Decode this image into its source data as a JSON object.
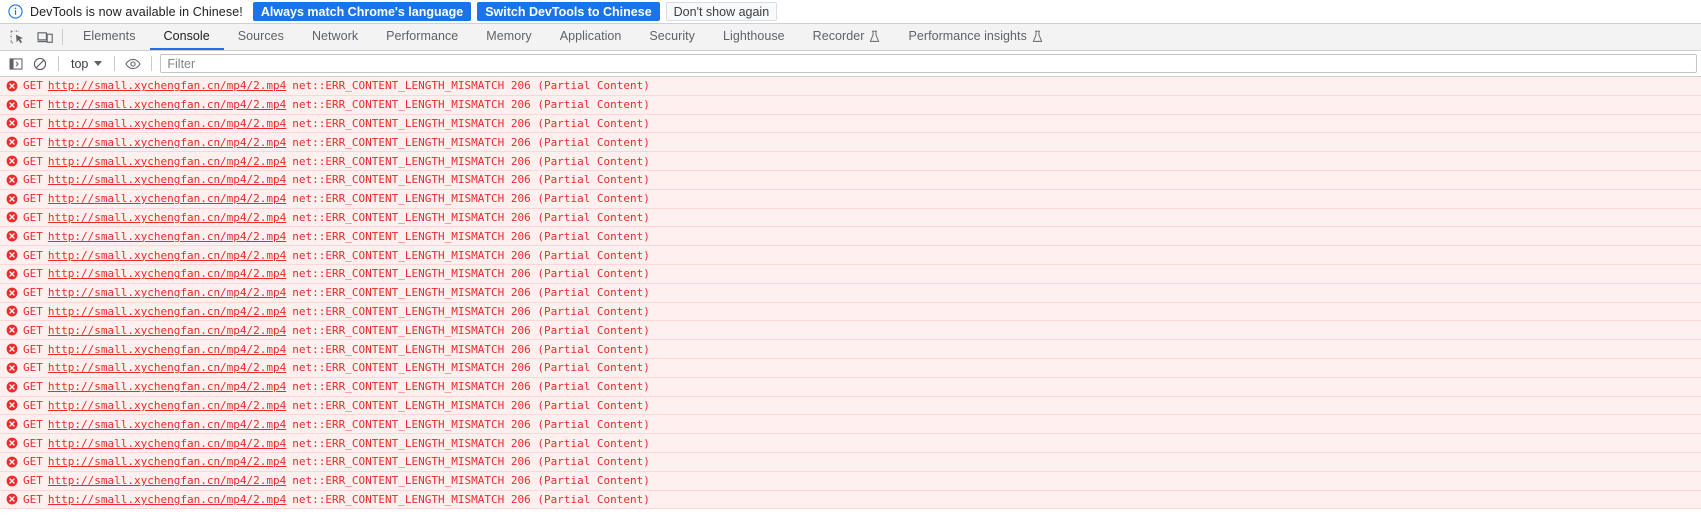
{
  "notification": {
    "icon": "info-circle-icon",
    "text": "DevTools is now available in Chinese!",
    "buttons": [
      {
        "label": "Always match Chrome's language",
        "style": "primary"
      },
      {
        "label": "Switch DevTools to Chinese",
        "style": "primary"
      },
      {
        "label": "Don't show again",
        "style": "secondary"
      }
    ]
  },
  "toolbar": {
    "icons": [
      {
        "name": "inspect-element-icon",
        "title": "Inspect element"
      },
      {
        "name": "device-toolbar-icon",
        "title": "Toggle device toolbar"
      }
    ],
    "tabs": [
      {
        "label": "Elements",
        "active": false,
        "experimental": false
      },
      {
        "label": "Console",
        "active": true,
        "experimental": false
      },
      {
        "label": "Sources",
        "active": false,
        "experimental": false
      },
      {
        "label": "Network",
        "active": false,
        "experimental": false
      },
      {
        "label": "Performance",
        "active": false,
        "experimental": false
      },
      {
        "label": "Memory",
        "active": false,
        "experimental": false
      },
      {
        "label": "Application",
        "active": false,
        "experimental": false
      },
      {
        "label": "Security",
        "active": false,
        "experimental": false
      },
      {
        "label": "Lighthouse",
        "active": false,
        "experimental": false
      },
      {
        "label": "Recorder",
        "active": false,
        "experimental": true
      },
      {
        "label": "Performance insights",
        "active": false,
        "experimental": true
      }
    ]
  },
  "console_toolbar": {
    "sidebar_toggle": "show-console-sidebar-icon",
    "clear_console": "clear-console-icon",
    "context_selector": {
      "value": "top",
      "caret": "chevron-down-icon"
    },
    "live_expression": "eye-icon",
    "filter": {
      "value": "",
      "placeholder": "Filter"
    }
  },
  "console": {
    "message_template": {
      "icon": "error-circle-icon",
      "method": "GET",
      "url": "http://small.xychengfan.cn/mp4/2.mp4",
      "detail": "net::ERR_CONTENT_LENGTH_MISMATCH 206 (Partial Content)"
    },
    "message_count": 23,
    "colors": {
      "error_text": "#eb2b2b",
      "error_background": "#fff0f0",
      "error_border": "#ffd6d6",
      "accent": "#1a73e8"
    }
  }
}
